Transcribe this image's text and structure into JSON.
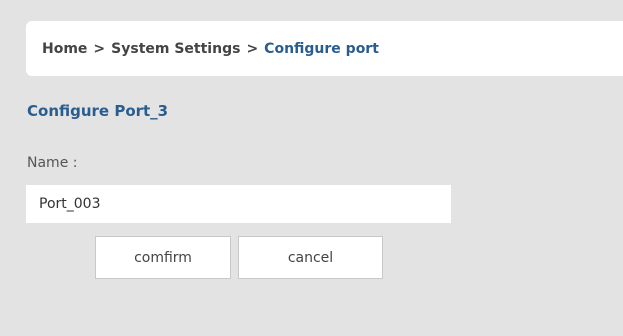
{
  "breadcrumb": {
    "items": [
      "Home",
      "System Settings",
      "Configure port"
    ],
    "separator": ">"
  },
  "section": {
    "title": "Configure Port_3"
  },
  "form": {
    "name_label": "Name :",
    "name_value": "Port_003"
  },
  "buttons": {
    "confirm": "comfirm",
    "cancel": "cancel"
  },
  "colors": {
    "background": "#e3e3e3",
    "accent": "#2a5d8f",
    "panel": "#ffffff"
  }
}
